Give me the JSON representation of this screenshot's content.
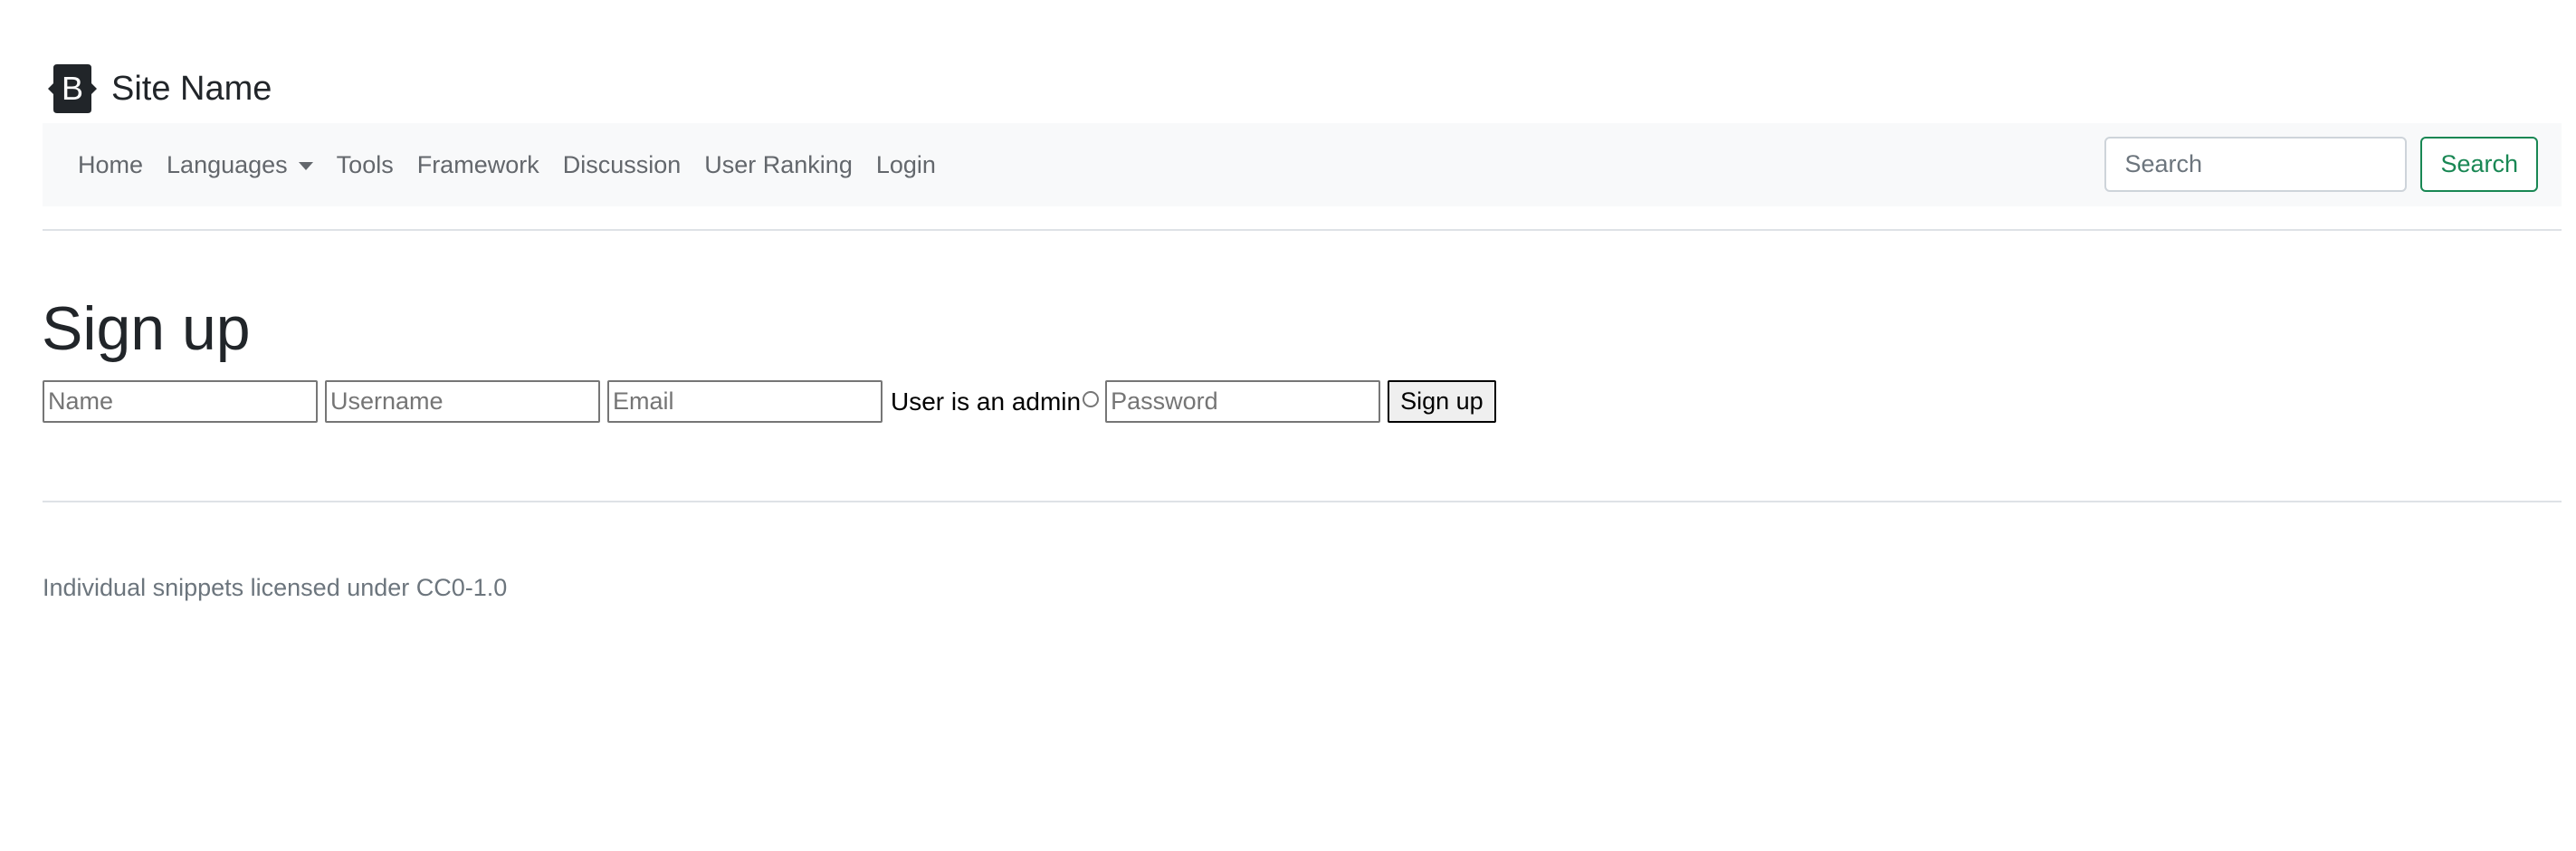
{
  "brand": {
    "logo_letter": "B",
    "site_name": "Site Name"
  },
  "navbar": {
    "items": [
      {
        "label": "Home"
      },
      {
        "label": "Languages"
      },
      {
        "label": "Tools"
      },
      {
        "label": "Framework"
      },
      {
        "label": "Discussion"
      },
      {
        "label": "User Ranking"
      },
      {
        "label": "Login"
      }
    ],
    "search_placeholder": "Search",
    "search_button": "Search"
  },
  "signup": {
    "title": "Sign up",
    "name_placeholder": "Name",
    "username_placeholder": "Username",
    "email_placeholder": "Email",
    "admin_label": "User is an admin",
    "password_placeholder": "Password",
    "submit_label": "Sign up"
  },
  "footer": {
    "text": "Individual snippets licensed under CC0-1.0"
  },
  "colors": {
    "navbar_bg": "#f8f9fa",
    "nav_text": "#63676c",
    "success": "#198754",
    "heading": "#212529",
    "muted": "#6c757d"
  }
}
